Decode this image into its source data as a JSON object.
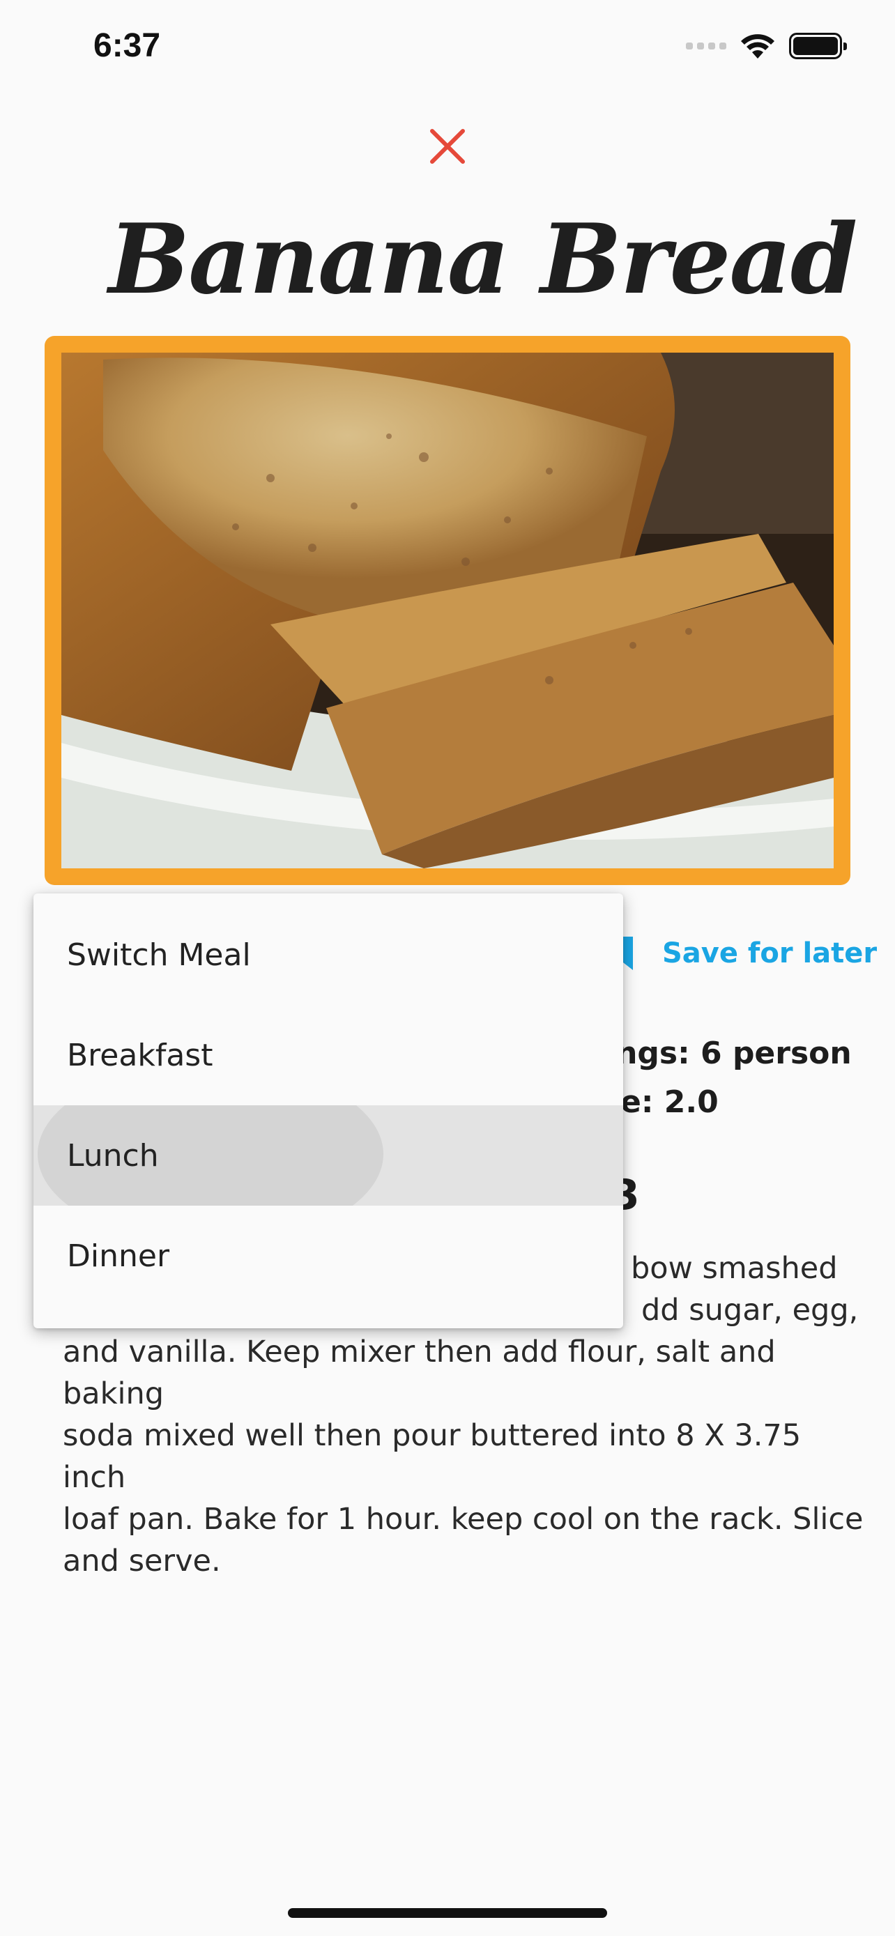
{
  "status_bar": {
    "time": "6:37"
  },
  "header": {
    "title": "Banana Bread"
  },
  "actions": {
    "save_label": "Save for later"
  },
  "info": {
    "servings": "ings: 6 person",
    "time": "e: 2.0",
    "section_heading_partial": "3"
  },
  "description": {
    "line1": "bow smashed",
    "line2": "dd sugar, egg,",
    "line3": "and vanilla. Keep mixer then add flour, salt and baking",
    "line4": "soda mixed well then pour buttered into 8 X 3.75 inch",
    "line5": "loaf pan. Bake for 1 hour. keep cool on the rack. Slice",
    "line6": "and serve."
  },
  "menu": {
    "items": [
      {
        "label": "Switch Meal"
      },
      {
        "label": "Breakfast"
      },
      {
        "label": "Lunch",
        "selected": true
      },
      {
        "label": "Dinner"
      }
    ]
  },
  "colors": {
    "accent": "#f6a32a",
    "close": "#e5493a",
    "link": "#1aa5e3"
  }
}
